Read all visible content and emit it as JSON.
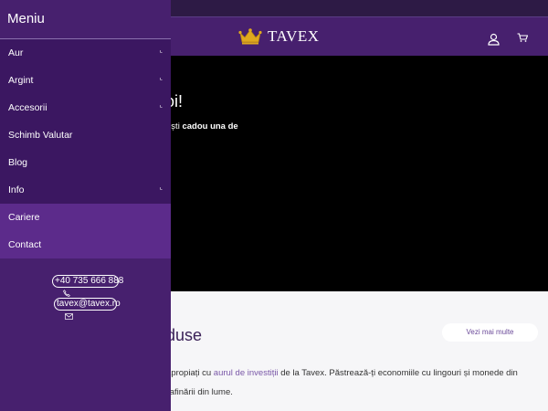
{
  "site": {
    "brand": "TAVEX"
  },
  "hero": {
    "title_fragment": "voi!",
    "sub_plain": "imești ",
    "sub_bold": "cadou una de"
  },
  "products": {
    "title_fragment": "duse",
    "see_more": "Vezi mai multe",
    "line1_a": "ei apropiați cu ",
    "line1_link": "aurul de investiții",
    "line1_b": " de la Tavex. Păstrează-ți economiile cu lingouri și monede din",
    "line2": "te rafinării din lume."
  },
  "drawer": {
    "title": "Meniu",
    "items": [
      {
        "label": "Aur",
        "has_submenu": true
      },
      {
        "label": "Argint",
        "has_submenu": true
      },
      {
        "label": "Accesorii",
        "has_submenu": true
      },
      {
        "label": "Schimb Valutar",
        "has_submenu": false
      },
      {
        "label": "Blog",
        "has_submenu": false
      },
      {
        "label": "Info",
        "has_submenu": true
      },
      {
        "label": "Cariere",
        "has_submenu": false
      },
      {
        "label": "Contact",
        "has_submenu": false
      }
    ],
    "caret": "⌞",
    "phone": "+40 735 666 888",
    "email": "tavex@tavex.ro"
  },
  "icons": {
    "logo": "crown-icon",
    "account": "user-icon",
    "cart": "cart-icon",
    "phone": "phone-icon",
    "email": "envelope-icon"
  },
  "colors": {
    "brand_purple": "#47206e",
    "menu_dark": "#3b1761",
    "menu_light": "#5c2b8b",
    "crown_gold": "#e0a91e",
    "link_purple": "#7a58a8"
  }
}
